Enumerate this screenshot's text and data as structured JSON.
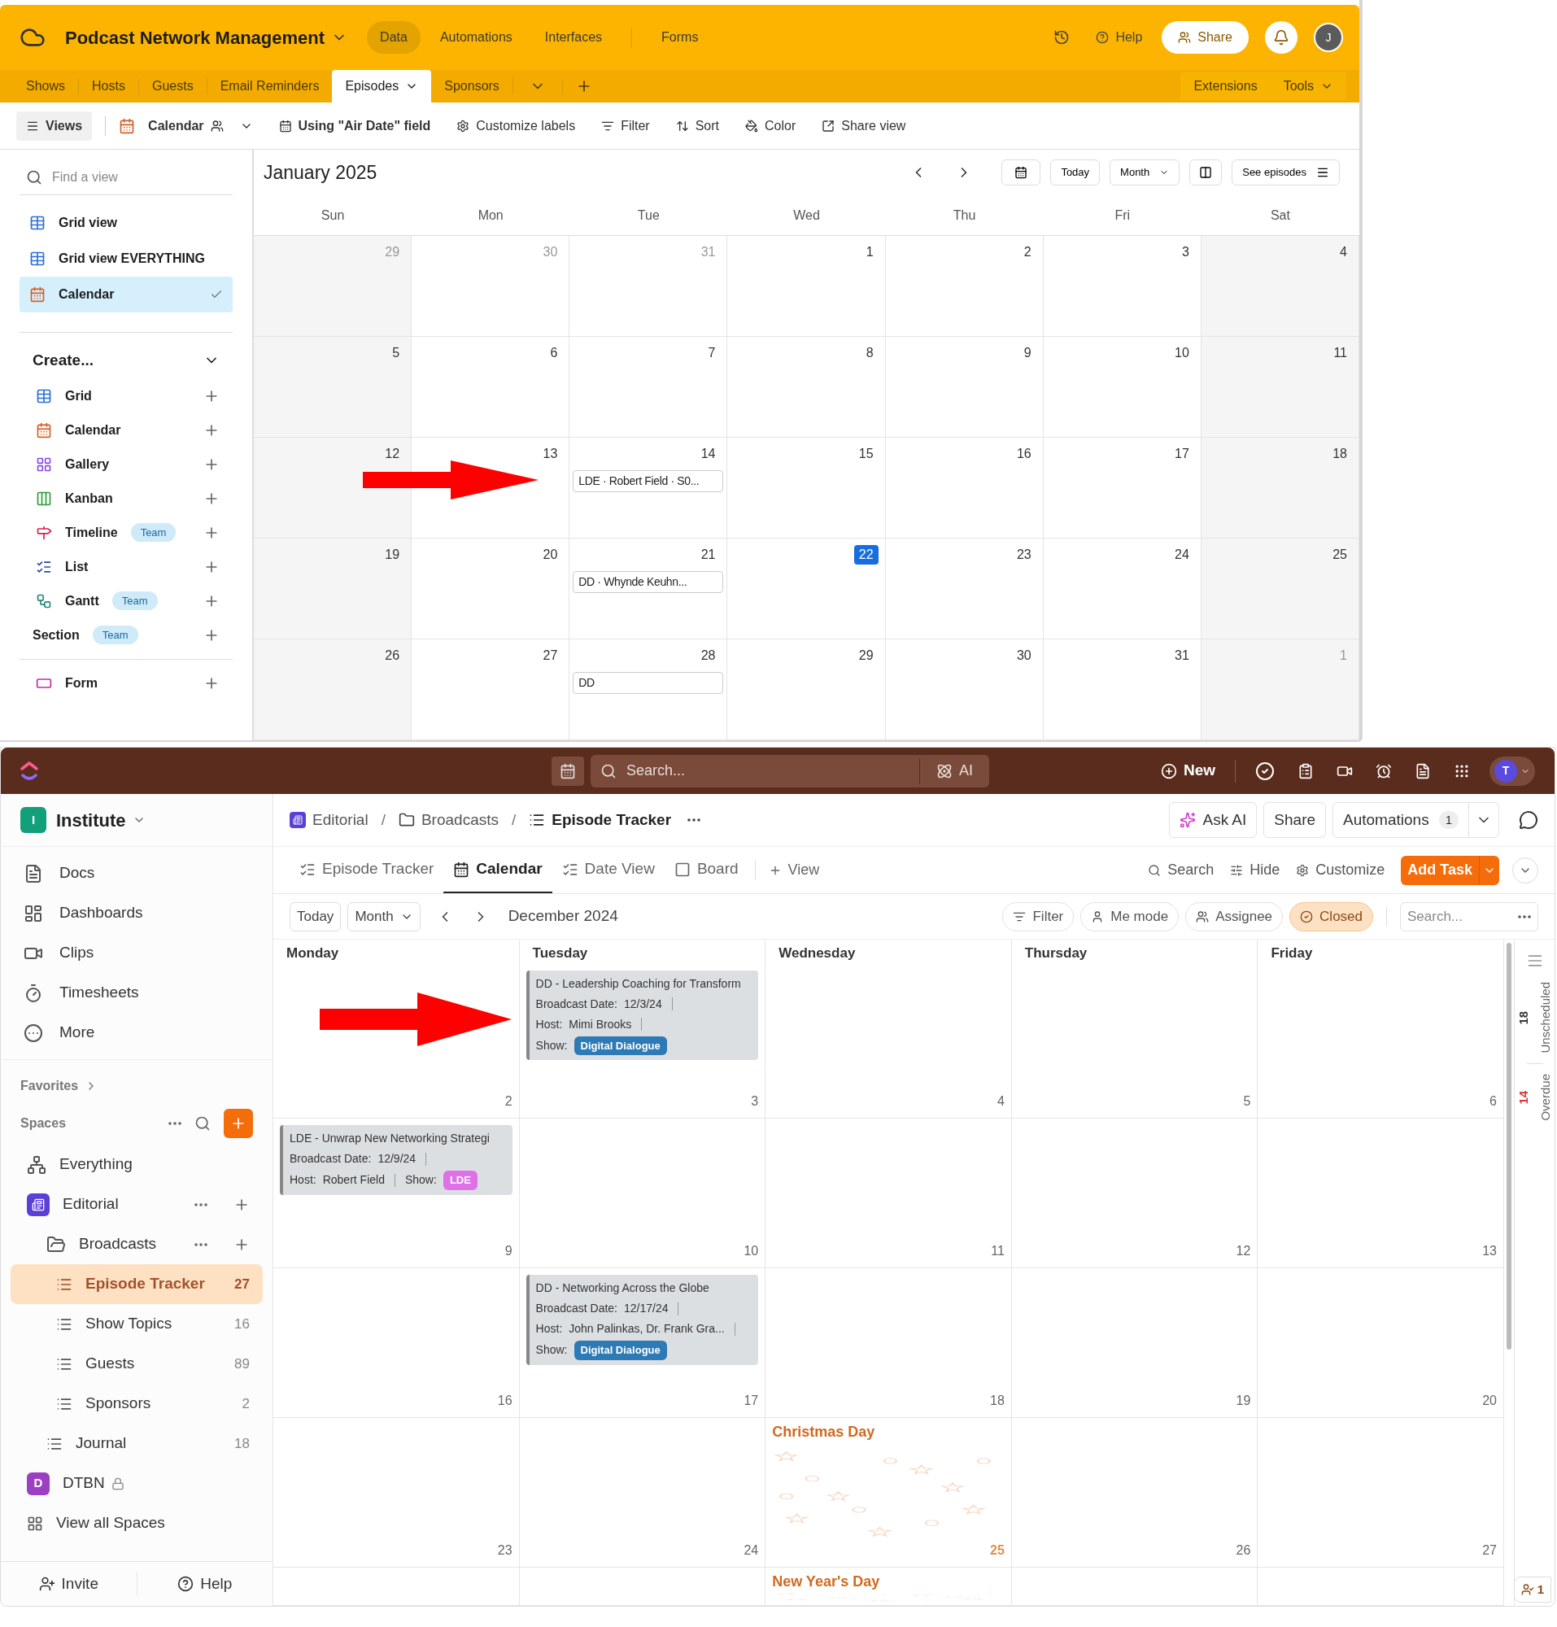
{
  "airtable": {
    "base_title": "Podcast Network Management",
    "nav": [
      {
        "label": "Data",
        "selected": true
      },
      {
        "label": "Automations",
        "selected": false
      },
      {
        "label": "Interfaces",
        "selected": false
      },
      {
        "label": "Forms",
        "selected": false
      }
    ],
    "help": "Help",
    "share": "Share",
    "avatar": "J",
    "tables": [
      {
        "label": "Shows",
        "selected": false
      },
      {
        "label": "Hosts",
        "selected": false
      },
      {
        "label": "Guests",
        "selected": false
      },
      {
        "label": "Email Reminders",
        "selected": false
      },
      {
        "label": "Episodes",
        "selected": true
      },
      {
        "label": "Sponsors",
        "selected": false
      }
    ],
    "extensions": "Extensions",
    "tools": "Tools",
    "toolbar": {
      "views": "Views",
      "view_name": "Calendar",
      "date_field": "Using \"Air Date\" field",
      "actions": [
        {
          "label": "Customize labels",
          "kind": "labels"
        },
        {
          "label": "Filter",
          "kind": "filter"
        },
        {
          "label": "Sort",
          "kind": "sort"
        },
        {
          "label": "Color",
          "kind": "color"
        },
        {
          "label": "Share view",
          "kind": "share"
        }
      ]
    },
    "sidebar": {
      "search_placeholder": "Find a view",
      "views": [
        {
          "label": "Grid view",
          "kind": "grid",
          "selected": false
        },
        {
          "label": "Grid view EVERYTHING",
          "kind": "grid",
          "selected": false
        },
        {
          "label": "Calendar",
          "kind": "calendar",
          "selected": true
        }
      ],
      "create_title": "Create...",
      "create_items": [
        {
          "label": "Grid",
          "kind": "grid"
        },
        {
          "label": "Calendar",
          "kind": "calendar"
        },
        {
          "label": "Gallery",
          "kind": "gallery"
        },
        {
          "label": "Kanban",
          "kind": "kanban"
        },
        {
          "label": "Timeline",
          "kind": "timeline",
          "badge": "Team"
        },
        {
          "label": "List",
          "kind": "list"
        },
        {
          "label": "Gantt",
          "kind": "gantt",
          "badge": "Team"
        },
        {
          "label": "Section",
          "kind": "section",
          "badge": "Team"
        },
        {
          "label": "Form",
          "kind": "form"
        }
      ]
    },
    "calendar": {
      "month": "January 2025",
      "today": "Today",
      "mode": "Month",
      "see": "See episodes",
      "weekdays": [
        "Sun",
        "Mon",
        "Tue",
        "Wed",
        "Thu",
        "Fri",
        "Sat"
      ],
      "weeks": [
        [
          {
            "day": "29",
            "outside": true,
            "today": false
          },
          {
            "day": "30",
            "outside": true,
            "today": false
          },
          {
            "day": "31",
            "outside": true,
            "today": false
          },
          {
            "day": "1",
            "outside": false,
            "today": false
          },
          {
            "day": "2",
            "outside": false,
            "today": false
          },
          {
            "day": "3",
            "outside": false,
            "today": false
          },
          {
            "day": "4",
            "outside": false,
            "today": false
          }
        ],
        [
          {
            "day": "5",
            "outside": false,
            "today": false
          },
          {
            "day": "6",
            "outside": false,
            "today": false
          },
          {
            "day": "7",
            "outside": false,
            "today": false
          },
          {
            "day": "8",
            "outside": false,
            "today": false
          },
          {
            "day": "9",
            "outside": false,
            "today": false
          },
          {
            "day": "10",
            "outside": false,
            "today": false
          },
          {
            "day": "11",
            "outside": false,
            "today": false
          }
        ],
        [
          {
            "day": "12",
            "outside": false,
            "today": false
          },
          {
            "day": "13",
            "outside": false,
            "today": false
          },
          {
            "day": "14",
            "outside": false,
            "today": false,
            "events": [
              "LDE · Robert Field · S0..."
            ]
          },
          {
            "day": "15",
            "outside": false,
            "today": false
          },
          {
            "day": "16",
            "outside": false,
            "today": false
          },
          {
            "day": "17",
            "outside": false,
            "today": false
          },
          {
            "day": "18",
            "outside": false,
            "today": false
          }
        ],
        [
          {
            "day": "19",
            "outside": false,
            "today": false
          },
          {
            "day": "20",
            "outside": false,
            "today": false
          },
          {
            "day": "21",
            "outside": false,
            "today": false,
            "events": [
              "DD · Whynde Keuhn..."
            ]
          },
          {
            "day": "22",
            "outside": false,
            "today": true
          },
          {
            "day": "23",
            "outside": false,
            "today": false
          },
          {
            "day": "24",
            "outside": false,
            "today": false
          },
          {
            "day": "25",
            "outside": false,
            "today": false
          }
        ],
        [
          {
            "day": "26",
            "outside": false,
            "today": false
          },
          {
            "day": "27",
            "outside": false,
            "today": false
          },
          {
            "day": "28",
            "outside": false,
            "today": false,
            "events": [
              "DD"
            ]
          },
          {
            "day": "29",
            "outside": false,
            "today": false
          },
          {
            "day": "30",
            "outside": false,
            "today": false
          },
          {
            "day": "31",
            "outside": false,
            "today": false
          },
          {
            "day": "1",
            "outside": true,
            "today": false
          }
        ]
      ]
    }
  },
  "clickup": {
    "search_placeholder": "Search...",
    "ai": "AI",
    "new": "New",
    "avatar": "T",
    "workspace": {
      "initial": "I",
      "name": "Institute"
    },
    "nav": [
      {
        "label": "Docs",
        "kind": "docs"
      },
      {
        "label": "Dashboards",
        "kind": "dashboards"
      },
      {
        "label": "Clips",
        "kind": "clips"
      },
      {
        "label": "Timesheets",
        "kind": "timesheets"
      },
      {
        "label": "More",
        "kind": "more"
      }
    ],
    "favorites": "Favorites",
    "spaces": "Spaces",
    "tree": [
      {
        "label": "Everything",
        "kind": "everything",
        "selected": false
      },
      {
        "label": "Editorial",
        "kind": "space",
        "color": "#5b3fd6",
        "actions": true,
        "locked": false,
        "selected": false,
        "children": [
          {
            "label": "Broadcasts",
            "kind": "folder",
            "actions": true,
            "selected": false,
            "children": [
              {
                "label": "Episode Tracker",
                "kind": "list",
                "count": "27",
                "selected": true
              },
              {
                "label": "Show Topics",
                "kind": "list",
                "count": "16",
                "selected": false
              },
              {
                "label": "Guests",
                "kind": "list",
                "count": "89",
                "selected": false
              },
              {
                "label": "Sponsors",
                "kind": "list",
                "count": "2",
                "selected": false
              }
            ]
          },
          {
            "label": "Journal",
            "kind": "list",
            "count": "18",
            "selected": false
          }
        ]
      },
      {
        "label": "DTBN",
        "kind": "space",
        "initial": "D",
        "color": "#9c3fc2",
        "actions": false,
        "locked": true,
        "selected": false
      }
    ],
    "view_all": "View all Spaces",
    "invite": "Invite",
    "help": "Help",
    "breadcrumb_separator": "/",
    "breadcrumb": [
      {
        "label": "Editorial",
        "kind": "space"
      },
      {
        "label": "Broadcasts",
        "kind": "folder"
      },
      {
        "label": "Episode Tracker",
        "kind": "list"
      }
    ],
    "ask_ai": "Ask AI",
    "share": "Share",
    "automations": "Automations",
    "automations_count": "1",
    "views": [
      {
        "label": "Episode Tracker",
        "kind": "list",
        "selected": false
      },
      {
        "label": "Calendar",
        "kind": "calendar",
        "selected": true
      },
      {
        "label": "Date View",
        "kind": "list",
        "selected": false
      },
      {
        "label": "Board",
        "kind": "board",
        "selected": false
      }
    ],
    "add_view": "View",
    "search": "Search",
    "hide": "Hide",
    "customize": "Customize",
    "add_task": "Add Task",
    "today": "Today",
    "mode": "Month",
    "period": "December 2024",
    "filters": [
      {
        "label": "Filter",
        "kind": "filter",
        "active": false
      },
      {
        "label": "Me mode",
        "kind": "me",
        "active": false
      },
      {
        "label": "Assignee",
        "kind": "assignee",
        "active": false
      },
      {
        "label": "Closed",
        "kind": "closed",
        "active": true
      }
    ],
    "task_search_placeholder": "Search...",
    "weekdays": [
      "Monday",
      "Tuesday",
      "Wednesday",
      "Thursday",
      "Friday"
    ],
    "weeks": [
      [
        {
          "day": "2"
        },
        {
          "day": "3",
          "events": [
            {
              "kind": "stacked",
              "title": "DD - Leadership Coaching for Transform",
              "date_label": "Broadcast Date:",
              "date": "12/3/24",
              "host_label": "Host:",
              "host": "Mimi Brooks",
              "show_label": "Show:",
              "show": "Digital Dialogue",
              "color": "#2d7ab5"
            }
          ]
        },
        {
          "day": "4"
        },
        {
          "day": "5"
        },
        {
          "day": "6"
        }
      ],
      [
        {
          "day": "9",
          "events": [
            {
              "kind": "inline",
              "title": "LDE - Unwrap New Networking Strategi",
              "date_label": "Broadcast Date:",
              "date": "12/9/24",
              "host_label": "Host:",
              "host": "Robert Field",
              "show_label": "Show:",
              "show": "LDE",
              "color": "#e070e8"
            }
          ]
        },
        {
          "day": "10"
        },
        {
          "day": "11"
        },
        {
          "day": "12"
        },
        {
          "day": "13"
        }
      ],
      [
        {
          "day": "16"
        },
        {
          "day": "17",
          "events": [
            {
              "kind": "stacked",
              "title": "DD - Networking Across the Globe",
              "date_label": "Broadcast Date:",
              "date": "12/17/24",
              "host_label": "Host:",
              "host": "John Palinkas, Dr. Frank Gra...",
              "show_label": "Show:",
              "show": "Digital Dialogue",
              "color": "#2d7ab5"
            }
          ]
        },
        {
          "day": "18"
        },
        {
          "day": "19"
        },
        {
          "day": "20"
        }
      ],
      [
        {
          "day": "23"
        },
        {
          "day": "24"
        },
        {
          "day": "25",
          "holiday": "Christmas Day"
        },
        {
          "day": "26"
        },
        {
          "day": "27"
        }
      ],
      [
        {
          "kind": "blank"
        },
        {
          "kind": "blank"
        },
        {
          "kind": "holiday",
          "holiday": "New Year's Day"
        },
        {
          "kind": "blank"
        },
        {
          "kind": "blank"
        }
      ]
    ],
    "unscheduled_count": "18",
    "unscheduled": "Unscheduled",
    "overdue_count": "14",
    "overdue": "Overdue",
    "footer_count": "1"
  }
}
